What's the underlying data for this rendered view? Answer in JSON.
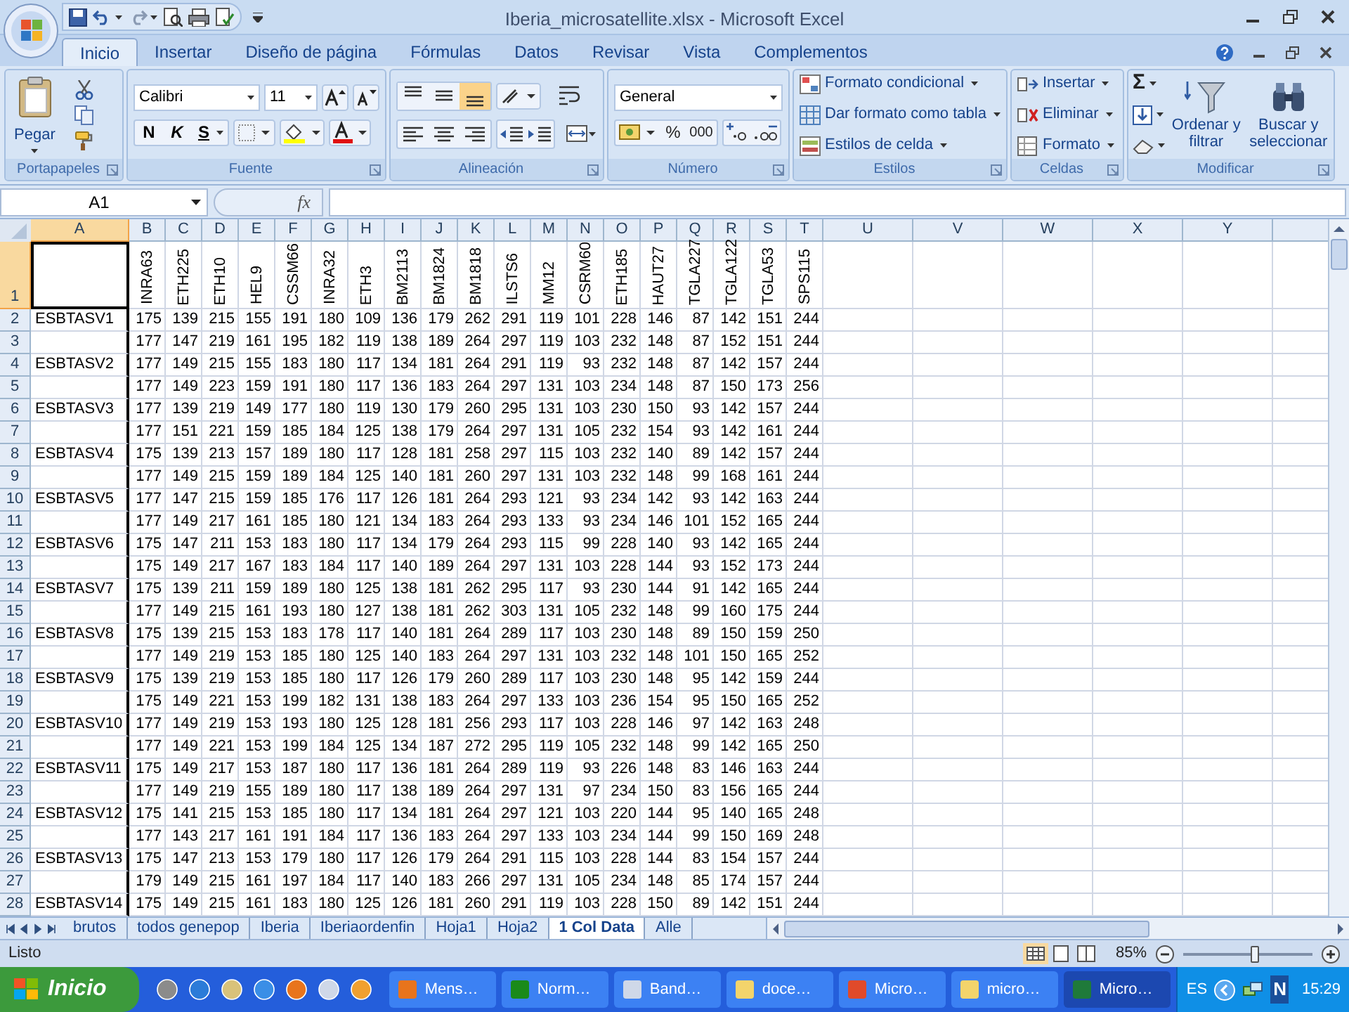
{
  "window": {
    "title": "Iberia_microsatellite.xlsx - Microsoft Excel"
  },
  "ribbon_tabs": [
    {
      "label": "Inicio",
      "selected": true
    },
    {
      "label": "Insertar",
      "selected": false
    },
    {
      "label": "Diseño de página",
      "selected": false
    },
    {
      "label": "Fórmulas",
      "selected": false
    },
    {
      "label": "Datos",
      "selected": false
    },
    {
      "label": "Revisar",
      "selected": false
    },
    {
      "label": "Vista",
      "selected": false
    },
    {
      "label": "Complementos",
      "selected": false
    }
  ],
  "clipboard": {
    "label": "Portapapeles",
    "paste": "Pegar"
  },
  "font": {
    "label": "Fuente",
    "name": "Calibri",
    "size": "11",
    "bold": "N",
    "italic": "K",
    "underline": "S"
  },
  "alignment": {
    "label": "Alineación",
    "vertical": [
      {
        "selected": false
      },
      {
        "selected": false
      },
      {
        "selected": true
      }
    ]
  },
  "number": {
    "label": "Número",
    "format": "General",
    "percent": "%",
    "thousands": "000"
  },
  "styles": {
    "label": "Estilos",
    "commands": [
      "Formato condicional",
      "Dar formato como tabla",
      "Estilos de celda"
    ]
  },
  "cells": {
    "label": "Celdas",
    "commands": [
      "Insertar",
      "Eliminar",
      "Formato"
    ]
  },
  "editing": {
    "label": "Modificar",
    "sum": "Σ",
    "sort": "Ordenar y filtrar",
    "find": "Buscar y seleccionar"
  },
  "formula_bar": {
    "name_box": "A1",
    "fx": "fx"
  },
  "sheet": {
    "columns": [
      {
        "label": "A",
        "selected": true
      },
      {
        "label": "B",
        "selected": false
      },
      {
        "label": "C",
        "selected": false
      },
      {
        "label": "D",
        "selected": false
      },
      {
        "label": "E",
        "selected": false
      },
      {
        "label": "F",
        "selected": false
      },
      {
        "label": "G",
        "selected": false
      },
      {
        "label": "H",
        "selected": false
      },
      {
        "label": "I",
        "selected": false
      },
      {
        "label": "J",
        "selected": false
      },
      {
        "label": "K",
        "selected": false
      },
      {
        "label": "L",
        "selected": false
      },
      {
        "label": "M",
        "selected": false
      },
      {
        "label": "N",
        "selected": false
      },
      {
        "label": "O",
        "selected": false
      },
      {
        "label": "P",
        "selected": false
      },
      {
        "label": "Q",
        "selected": false
      },
      {
        "label": "R",
        "selected": false
      },
      {
        "label": "S",
        "selected": false
      },
      {
        "label": "T",
        "selected": false
      },
      {
        "label": "U",
        "selected": false
      },
      {
        "label": "V",
        "selected": false
      },
      {
        "label": "W",
        "selected": false
      },
      {
        "label": "X",
        "selected": false
      },
      {
        "label": "Y",
        "selected": false
      }
    ],
    "header_row": {
      "row": "1",
      "selected": true,
      "cells": [
        "INRA63",
        "ETH225",
        "ETH10",
        "HEL9",
        "CSSM66",
        "INRA32",
        "ETH3",
        "BM2113",
        "BM1824",
        "BM1818",
        "ILSTS6",
        "MM12",
        "CSRM60",
        "ETH185",
        "HAUT27",
        "TGLA227",
        "TGLA122",
        "TGLA53",
        "SPS115"
      ]
    },
    "rows": [
      {
        "row": "2",
        "selected": false,
        "label": "ESBTASV1",
        "values": [
          "175",
          "139",
          "215",
          "155",
          "191",
          "180",
          "109",
          "136",
          "179",
          "262",
          "291",
          "119",
          "101",
          "228",
          "146",
          "87",
          "142",
          "151",
          "244"
        ]
      },
      {
        "row": "3",
        "selected": false,
        "values": [
          "177",
          "147",
          "219",
          "161",
          "195",
          "182",
          "119",
          "138",
          "189",
          "264",
          "297",
          "119",
          "103",
          "232",
          "148",
          "87",
          "152",
          "151",
          "244"
        ]
      },
      {
        "row": "4",
        "selected": false,
        "label": "ESBTASV2",
        "values": [
          "177",
          "149",
          "215",
          "155",
          "183",
          "180",
          "117",
          "134",
          "181",
          "264",
          "291",
          "119",
          "93",
          "232",
          "148",
          "87",
          "142",
          "157",
          "244"
        ]
      },
      {
        "row": "5",
        "selected": false,
        "values": [
          "177",
          "149",
          "223",
          "159",
          "191",
          "180",
          "117",
          "136",
          "183",
          "264",
          "297",
          "131",
          "103",
          "234",
          "148",
          "87",
          "150",
          "173",
          "256"
        ]
      },
      {
        "row": "6",
        "selected": false,
        "label": "ESBTASV3",
        "values": [
          "177",
          "139",
          "219",
          "149",
          "177",
          "180",
          "119",
          "130",
          "179",
          "260",
          "295",
          "131",
          "103",
          "230",
          "150",
          "93",
          "142",
          "157",
          "244"
        ]
      },
      {
        "row": "7",
        "selected": false,
        "values": [
          "177",
          "151",
          "221",
          "159",
          "185",
          "184",
          "125",
          "138",
          "179",
          "264",
          "297",
          "131",
          "105",
          "232",
          "154",
          "93",
          "142",
          "161",
          "244"
        ]
      },
      {
        "row": "8",
        "selected": false,
        "label": "ESBTASV4",
        "values": [
          "175",
          "139",
          "213",
          "157",
          "189",
          "180",
          "117",
          "128",
          "181",
          "258",
          "297",
          "115",
          "103",
          "232",
          "140",
          "89",
          "142",
          "157",
          "244"
        ]
      },
      {
        "row": "9",
        "selected": false,
        "values": [
          "177",
          "149",
          "215",
          "159",
          "189",
          "184",
          "125",
          "140",
          "181",
          "260",
          "297",
          "131",
          "103",
          "232",
          "148",
          "99",
          "168",
          "161",
          "244"
        ]
      },
      {
        "row": "10",
        "selected": false,
        "label": "ESBTASV5",
        "values": [
          "177",
          "147",
          "215",
          "159",
          "185",
          "176",
          "117",
          "126",
          "181",
          "264",
          "293",
          "121",
          "93",
          "234",
          "142",
          "93",
          "142",
          "163",
          "244"
        ]
      },
      {
        "row": "11",
        "selected": false,
        "values": [
          "177",
          "149",
          "217",
          "161",
          "185",
          "180",
          "121",
          "134",
          "183",
          "264",
          "293",
          "133",
          "93",
          "234",
          "146",
          "101",
          "152",
          "165",
          "244"
        ]
      },
      {
        "row": "12",
        "selected": false,
        "label": "ESBTASV6",
        "values": [
          "175",
          "147",
          "211",
          "153",
          "183",
          "180",
          "117",
          "134",
          "179",
          "264",
          "293",
          "115",
          "99",
          "228",
          "140",
          "93",
          "142",
          "165",
          "244"
        ]
      },
      {
        "row": "13",
        "selected": false,
        "values": [
          "175",
          "149",
          "217",
          "167",
          "183",
          "184",
          "117",
          "140",
          "189",
          "264",
          "297",
          "131",
          "103",
          "228",
          "144",
          "93",
          "152",
          "173",
          "244"
        ]
      },
      {
        "row": "14",
        "selected": false,
        "label": "ESBTASV7",
        "values": [
          "175",
          "139",
          "211",
          "159",
          "189",
          "180",
          "125",
          "138",
          "181",
          "262",
          "295",
          "117",
          "93",
          "230",
          "144",
          "91",
          "142",
          "165",
          "244"
        ]
      },
      {
        "row": "15",
        "selected": false,
        "values": [
          "177",
          "149",
          "215",
          "161",
          "193",
          "180",
          "127",
          "138",
          "181",
          "262",
          "303",
          "131",
          "105",
          "232",
          "148",
          "99",
          "160",
          "175",
          "244"
        ]
      },
      {
        "row": "16",
        "selected": false,
        "label": "ESBTASV8",
        "values": [
          "175",
          "139",
          "215",
          "153",
          "183",
          "178",
          "117",
          "140",
          "181",
          "264",
          "289",
          "117",
          "103",
          "230",
          "148",
          "89",
          "150",
          "159",
          "250"
        ]
      },
      {
        "row": "17",
        "selected": false,
        "values": [
          "177",
          "149",
          "219",
          "153",
          "185",
          "180",
          "125",
          "140",
          "183",
          "264",
          "297",
          "131",
          "103",
          "232",
          "148",
          "101",
          "150",
          "165",
          "252"
        ]
      },
      {
        "row": "18",
        "selected": false,
        "label": "ESBTASV9",
        "values": [
          "175",
          "139",
          "219",
          "153",
          "185",
          "180",
          "117",
          "126",
          "179",
          "260",
          "289",
          "117",
          "103",
          "230",
          "148",
          "95",
          "142",
          "159",
          "244"
        ]
      },
      {
        "row": "19",
        "selected": false,
        "values": [
          "175",
          "149",
          "221",
          "153",
          "199",
          "182",
          "131",
          "138",
          "183",
          "264",
          "297",
          "133",
          "103",
          "236",
          "154",
          "95",
          "150",
          "165",
          "252"
        ]
      },
      {
        "row": "20",
        "selected": false,
        "label": "ESBTASV10",
        "values": [
          "177",
          "149",
          "219",
          "153",
          "193",
          "180",
          "125",
          "128",
          "181",
          "256",
          "293",
          "117",
          "103",
          "228",
          "146",
          "97",
          "142",
          "163",
          "248"
        ]
      },
      {
        "row": "21",
        "selected": false,
        "values": [
          "177",
          "149",
          "221",
          "153",
          "199",
          "184",
          "125",
          "134",
          "187",
          "272",
          "295",
          "119",
          "105",
          "232",
          "148",
          "99",
          "142",
          "165",
          "250"
        ]
      },
      {
        "row": "22",
        "selected": false,
        "label": "ESBTASV11",
        "values": [
          "175",
          "149",
          "217",
          "153",
          "187",
          "180",
          "117",
          "136",
          "181",
          "264",
          "289",
          "119",
          "93",
          "226",
          "148",
          "83",
          "146",
          "163",
          "244"
        ]
      },
      {
        "row": "23",
        "selected": false,
        "values": [
          "177",
          "149",
          "219",
          "155",
          "189",
          "180",
          "117",
          "138",
          "189",
          "264",
          "297",
          "131",
          "97",
          "234",
          "150",
          "83",
          "156",
          "165",
          "244"
        ]
      },
      {
        "row": "24",
        "selected": false,
        "label": "ESBTASV12",
        "values": [
          "175",
          "141",
          "215",
          "153",
          "185",
          "180",
          "117",
          "134",
          "181",
          "264",
          "297",
          "121",
          "103",
          "220",
          "144",
          "95",
          "140",
          "165",
          "248"
        ]
      },
      {
        "row": "25",
        "selected": false,
        "values": [
          "177",
          "143",
          "217",
          "161",
          "191",
          "184",
          "117",
          "136",
          "183",
          "264",
          "297",
          "133",
          "103",
          "234",
          "144",
          "99",
          "150",
          "169",
          "248"
        ]
      },
      {
        "row": "26",
        "selected": false,
        "label": "ESBTASV13",
        "values": [
          "175",
          "147",
          "213",
          "153",
          "179",
          "180",
          "117",
          "126",
          "179",
          "264",
          "291",
          "115",
          "103",
          "228",
          "144",
          "83",
          "154",
          "157",
          "244"
        ]
      },
      {
        "row": "27",
        "selected": false,
        "values": [
          "179",
          "149",
          "215",
          "161",
          "197",
          "184",
          "117",
          "140",
          "183",
          "266",
          "297",
          "131",
          "105",
          "234",
          "148",
          "85",
          "174",
          "157",
          "244"
        ]
      },
      {
        "row": "28",
        "selected": false,
        "label": "ESBTASV14",
        "values": [
          "175",
          "149",
          "215",
          "161",
          "183",
          "180",
          "125",
          "126",
          "181",
          "260",
          "291",
          "119",
          "103",
          "228",
          "150",
          "89",
          "142",
          "151",
          "244"
        ]
      }
    ]
  },
  "sheet_tabs": [
    {
      "label": "brutos",
      "selected": false
    },
    {
      "label": "todos genepop",
      "selected": false
    },
    {
      "label": "Iberia",
      "selected": false
    },
    {
      "label": "Iberiaordenfin",
      "selected": false
    },
    {
      "label": "Hoja1",
      "selected": false
    },
    {
      "label": "Hoja2",
      "selected": false
    },
    {
      "label": "1 Col Data",
      "selected": true
    },
    {
      "label": "Alle",
      "selected": false
    }
  ],
  "status_bar": {
    "status": "Listo",
    "zoom": "85%",
    "zoom_slider": {
      "level": 0.55
    }
  },
  "taskbar": {
    "start": "Inicio",
    "tasks": [
      {
        "label": "Mens…",
        "selected": false
      },
      {
        "label": "Norm…",
        "selected": false
      },
      {
        "label": "Band…",
        "selected": false
      },
      {
        "label": "doce…",
        "selected": false
      },
      {
        "label": "Micro…",
        "selected": false
      },
      {
        "label": "micro…",
        "selected": false
      },
      {
        "label": "Micro…",
        "selected": true
      }
    ],
    "language": "ES",
    "tray_letter": "N",
    "clock": "15:29"
  }
}
